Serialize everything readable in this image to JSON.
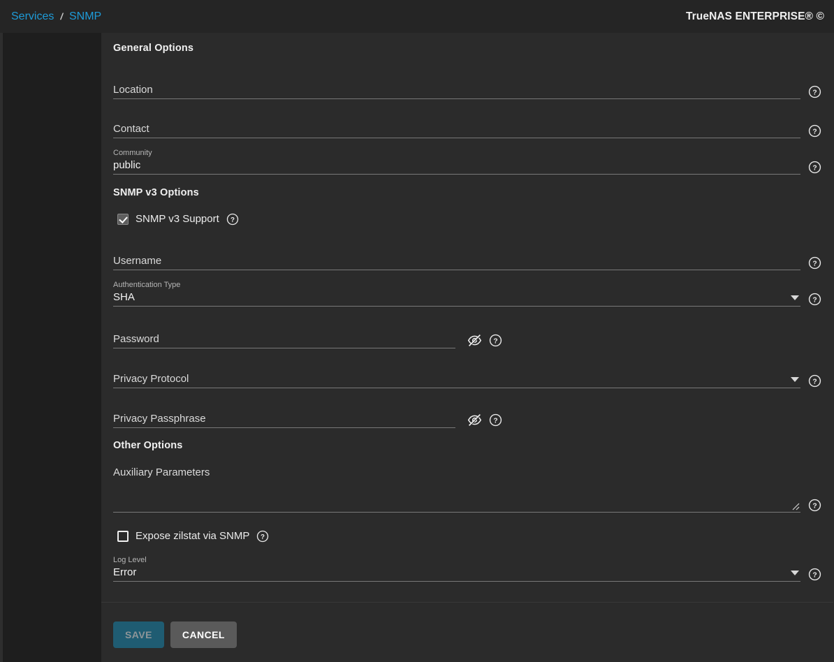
{
  "header": {
    "breadcrumb": {
      "parent": "Services",
      "separator": "/",
      "current": "SNMP"
    },
    "brand": "TrueNAS ENTERPRISE® ©"
  },
  "sections": {
    "general": {
      "title": "General Options"
    },
    "snmpv3": {
      "title": "SNMP v3 Options"
    },
    "other": {
      "title": "Other Options"
    }
  },
  "fields": {
    "location": {
      "label": "Location",
      "value": ""
    },
    "contact": {
      "label": "Contact",
      "value": ""
    },
    "community": {
      "label": "Community",
      "value": "public"
    },
    "v3_support": {
      "label": "SNMP v3 Support",
      "checked": true
    },
    "username": {
      "label": "Username",
      "value": ""
    },
    "auth_type": {
      "label": "Authentication Type",
      "value": "SHA"
    },
    "password": {
      "label": "Password",
      "value": ""
    },
    "privacy_protocol": {
      "label": "Privacy Protocol",
      "value": ""
    },
    "privacy_passphrase": {
      "label": "Privacy Passphrase",
      "value": ""
    },
    "aux_params": {
      "label": "Auxiliary Parameters",
      "value": ""
    },
    "expose_zilstat": {
      "label": "Expose zilstat via SNMP",
      "checked": false
    },
    "log_level": {
      "label": "Log Level",
      "value": "Error"
    }
  },
  "icons": {
    "help": "help-circle-icon",
    "eye_off": "eye-off-icon",
    "caret": "chevron-down-icon",
    "resize": "resize-grip-icon"
  },
  "buttons": {
    "save": "SAVE",
    "cancel": "CANCEL"
  },
  "colors": {
    "accent_link": "#1e9bd8",
    "save_bg": "#1f5c72",
    "cancel_bg": "#5a5a5a",
    "card_bg": "#2b2b2b",
    "topbar_bg": "#252525"
  }
}
